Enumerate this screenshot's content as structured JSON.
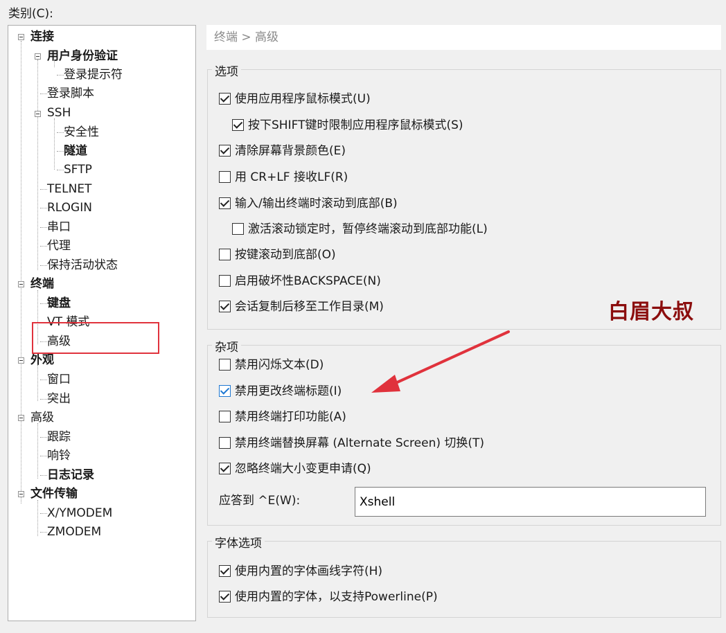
{
  "category_label": "类别(C):",
  "tree": {
    "items": [
      {
        "label": "连接",
        "bold": true
      },
      {
        "label": "用户身份验证",
        "bold": true
      },
      {
        "label": "登录提示符",
        "bold": false
      },
      {
        "label": "登录脚本",
        "bold": false
      },
      {
        "label": "SSH",
        "bold": false
      },
      {
        "label": "安全性",
        "bold": false
      },
      {
        "label": "隧道",
        "bold": true
      },
      {
        "label": "SFTP",
        "bold": false
      },
      {
        "label": "TELNET",
        "bold": false
      },
      {
        "label": "RLOGIN",
        "bold": false
      },
      {
        "label": "串口",
        "bold": false
      },
      {
        "label": "代理",
        "bold": false
      },
      {
        "label": "保持活动状态",
        "bold": false
      },
      {
        "label": "终端",
        "bold": true
      },
      {
        "label": "键盘",
        "bold": true
      },
      {
        "label": "VT 模式",
        "bold": false
      },
      {
        "label": "高级",
        "bold": false,
        "selected": true
      },
      {
        "label": "外观",
        "bold": true
      },
      {
        "label": "窗口",
        "bold": false
      },
      {
        "label": "突出",
        "bold": false
      },
      {
        "label": "高级",
        "bold": false
      },
      {
        "label": "跟踪",
        "bold": false
      },
      {
        "label": "响铃",
        "bold": false
      },
      {
        "label": "日志记录",
        "bold": true
      },
      {
        "label": "文件传输",
        "bold": true
      },
      {
        "label": "X/YMODEM",
        "bold": false
      },
      {
        "label": "ZMODEM",
        "bold": false
      }
    ]
  },
  "breadcrumb": "终端 > 高级",
  "options_group": {
    "title": "选项",
    "items": [
      {
        "label": "使用应用程序鼠标模式(U)",
        "checked": true
      },
      {
        "label": "按下SHIFT键时限制应用程序鼠标模式(S)",
        "checked": true
      },
      {
        "label": "清除屏幕背景颜色(E)",
        "checked": true
      },
      {
        "label": "用 CR+LF 接收LF(R)",
        "checked": false
      },
      {
        "label": "输入/输出终端时滚动到底部(B)",
        "checked": true
      },
      {
        "label": "激活滚动锁定时，暂停终端滚动到底部功能(L)",
        "checked": false
      },
      {
        "label": "按键滚动到底部(O)",
        "checked": false
      },
      {
        "label": "启用破坏性BACKSPACE(N)",
        "checked": false
      },
      {
        "label": "会话复制后移至工作目录(M)",
        "checked": true
      }
    ]
  },
  "misc_group": {
    "title": "杂项",
    "items": [
      {
        "label": "禁用闪烁文本(D)",
        "checked": false
      },
      {
        "label": "禁用更改终端标题(I)",
        "checked": true
      },
      {
        "label": "禁用终端打印功能(A)",
        "checked": false
      },
      {
        "label": "禁用终端替换屏幕 (Alternate Screen) 切换(T)",
        "checked": false
      },
      {
        "label": "忽略终端大小变更申请(Q)",
        "checked": true
      }
    ],
    "answer_label": "应答到 ^E(W):",
    "answer_value": "Xshell"
  },
  "font_group": {
    "title": "字体选项",
    "items": [
      {
        "label": "使用内置的字体画线字符(H)",
        "checked": true
      },
      {
        "label": "使用内置的字体，以支持Powerline(P)",
        "checked": true
      }
    ]
  },
  "watermark": "白眉大叔",
  "colors": {
    "annotation_red": "#e0323c",
    "watermark": "#8b0d0d",
    "focus_blue": "#1e78d2"
  }
}
